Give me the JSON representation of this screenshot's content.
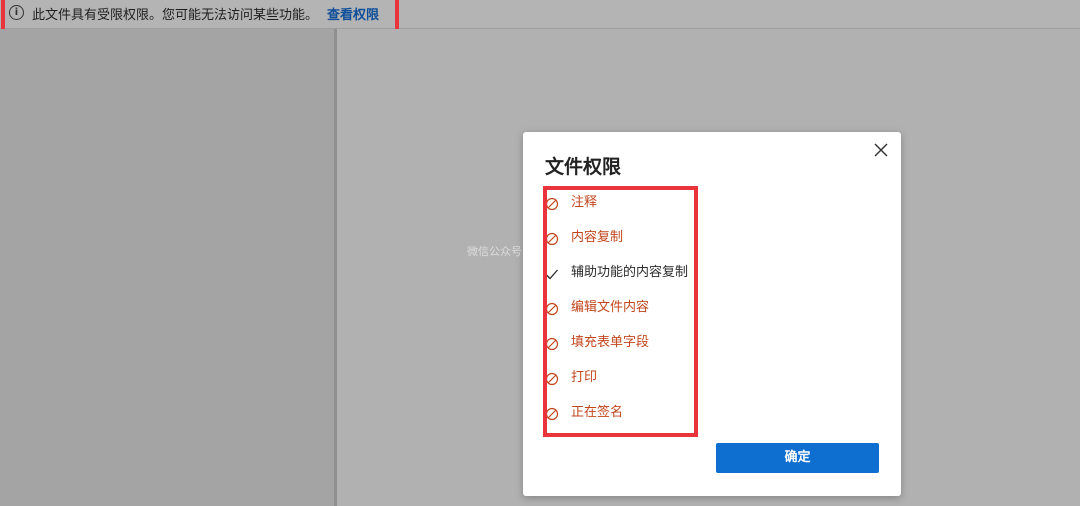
{
  "infobar": {
    "icon": "info-icon",
    "icon_glyph": "i",
    "message": "此文件具有受限权限。您可能无法访问某些功能。",
    "link_label": "查看权限"
  },
  "dialog": {
    "title": "文件权限",
    "close_icon": "close-icon",
    "permissions": [
      {
        "label": "注释",
        "status": "denied"
      },
      {
        "label": "内容复制",
        "status": "denied"
      },
      {
        "label": "辅助功能的内容复制",
        "status": "allowed"
      },
      {
        "label": "编辑文件内容",
        "status": "denied"
      },
      {
        "label": "填充表单字段",
        "status": "denied"
      },
      {
        "label": "打印",
        "status": "denied"
      },
      {
        "label": "正在签名",
        "status": "denied"
      }
    ],
    "ok_label": "确定"
  },
  "watermark": "微信公众号：各种学习资源",
  "colors": {
    "denied": "#c2461c",
    "allowed": "#2b2b2b",
    "primary_button": "#0f6fd0",
    "link": "#0f4f9a",
    "highlight": "#e8343a"
  }
}
